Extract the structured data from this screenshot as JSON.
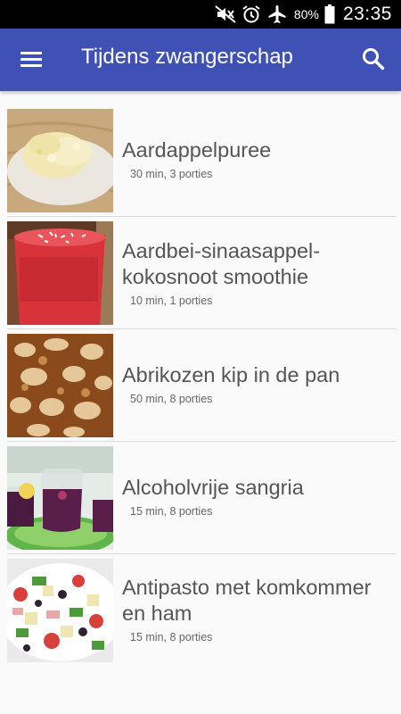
{
  "status_bar": {
    "battery_percent": "80%",
    "time": "23:35",
    "icons": [
      "mute-icon",
      "alarm-icon",
      "airplane-mode-icon",
      "battery-icon"
    ]
  },
  "app_bar": {
    "title": "Tijdens zwangerschap",
    "background_color": "#3f51b5",
    "menu_icon": "hamburger-menu-icon",
    "search_icon": "search-icon"
  },
  "recipes": [
    {
      "title": "Aardappelpuree",
      "meta": "30 min, 3 porties"
    },
    {
      "title": "Aardbei-sinaasappel-kokosnoot smoothie",
      "meta": "10 min, 1 porties"
    },
    {
      "title": "Abrikozen kip in de pan",
      "meta": "50 min, 8 porties"
    },
    {
      "title": "Alcoholvrije sangria",
      "meta": "15 min, 8 porties"
    },
    {
      "title": "Antipasto met komkommer en ham",
      "meta": "15 min, 8 porties"
    }
  ]
}
